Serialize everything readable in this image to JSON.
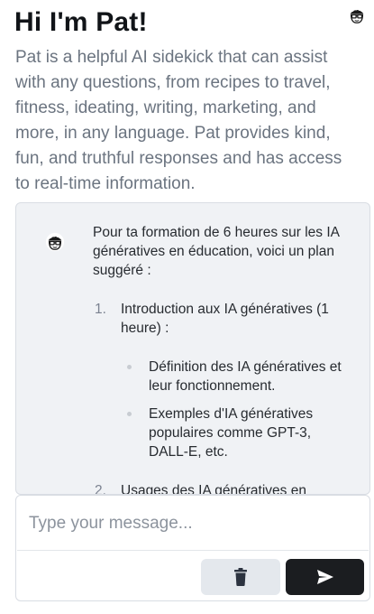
{
  "header": {
    "title": "Hi I'm Pat!",
    "intro": "Pat is a helpful AI sidekick that can assist with any questions, from recipes to travel, fitness, ideating, writing, marketing, and more, in any language. Pat provides kind, fun, and truthful responses and has access to real-time information.",
    "avatar_icon": "pat-avatar-icon"
  },
  "chat": {
    "bot_avatar_icon": "pat-avatar-icon",
    "message": {
      "intro": "Pour ta formation de 6 heures sur les IA génératives en éducation, voici un plan suggéré :",
      "sections": [
        {
          "number": "1.",
          "title": "Introduction aux IA génératives (1 heure) :",
          "bullets": [
            "Définition des IA génératives et leur fonctionnement.",
            "Exemples d'IA génératives populaires comme GPT-3, DALL-E, etc."
          ]
        },
        {
          "number": "2.",
          "title": "Usages des IA génératives en"
        }
      ]
    }
  },
  "composer": {
    "placeholder": "Type your message...",
    "value": "",
    "clear_icon": "trash-icon",
    "send_icon": "send-icon"
  },
  "colors": {
    "chat_background": "#f0f2f5",
    "send_button": "#1b1d20",
    "clear_button": "#e4e8ed",
    "intro_text": "#6b7480"
  }
}
